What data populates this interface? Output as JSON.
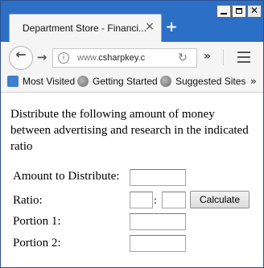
{
  "browser": {
    "tab_title": "Department Store - Financi...",
    "new_tab_symbol": "+",
    "url_host_prefix": "www.",
    "url_host": "csharpkey.c",
    "bookmarks": [
      "Most Visited",
      "Getting Started",
      "Suggested Sites"
    ],
    "colors": {
      "titlebar": "#2b6fc7"
    },
    "icons": [
      "info-icon",
      "reload-icon",
      "overflow-chevron-icon",
      "hamburger-menu-icon",
      "globe-icon",
      "most-visited-icon",
      "back-arrow-icon",
      "forward-arrow-icon",
      "close-icon",
      "minimize-icon",
      "maximize-icon"
    ]
  },
  "page": {
    "description": "Distribute the following amount of money between advertising and research in the indicated ratio",
    "labels": {
      "amount": "Amount to Distribute:",
      "ratio": "Ratio:",
      "portion1": "Portion 1:",
      "portion2": "Portion 2:"
    },
    "ratio_separator": ":",
    "calculate_label": "Calculate",
    "values": {
      "amount": "",
      "ratio_left": "",
      "ratio_right": "",
      "portion1": "",
      "portion2": ""
    }
  }
}
